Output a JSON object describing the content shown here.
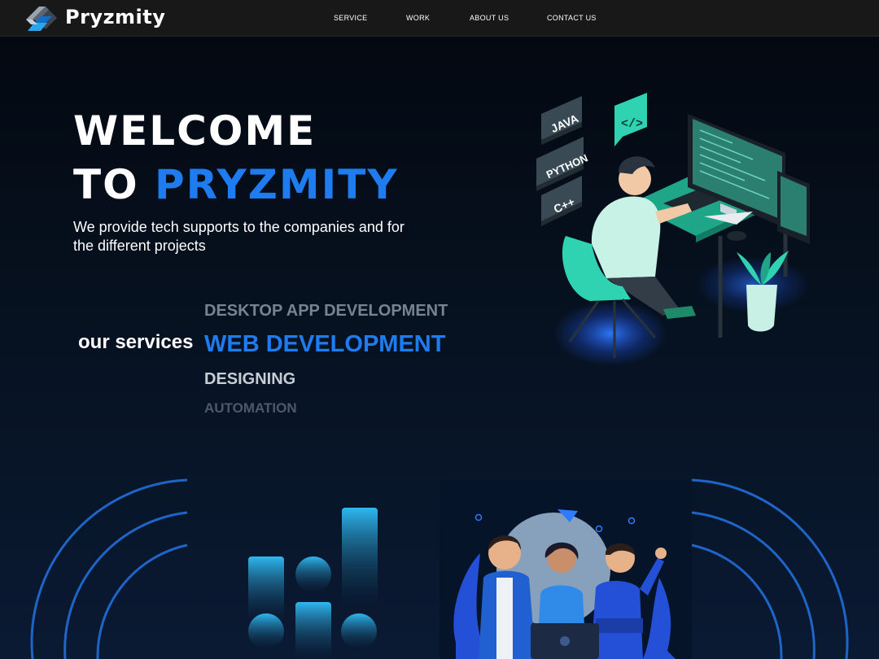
{
  "header": {
    "brand": "Pryzmity",
    "nav": [
      {
        "label": "SERVICE"
      },
      {
        "label": "WORK"
      },
      {
        "label": "ABOUT US"
      },
      {
        "label": "CONTACT US"
      }
    ]
  },
  "hero": {
    "title_line1": "WELCOME",
    "title_line2_prefix": "TO ",
    "title_line2_accent": "PRYZMITY",
    "tagline": "We provide tech supports to the companies and for the different projects"
  },
  "services": {
    "label": "our services",
    "items": [
      "DESKTOP APP DEVELOPMENT",
      "WEB DEVELOPMENT",
      "DESIGNING",
      "AUTOMATION"
    ],
    "active_index": 1
  },
  "illustration": {
    "languages": [
      "JAVA",
      "PYTHON",
      "C++"
    ],
    "code_glyph": "</>"
  },
  "colors": {
    "accent": "#1f7cf0",
    "teal": "#2fd3b1",
    "nav_bg": "#181818",
    "bg": "#06101e"
  }
}
